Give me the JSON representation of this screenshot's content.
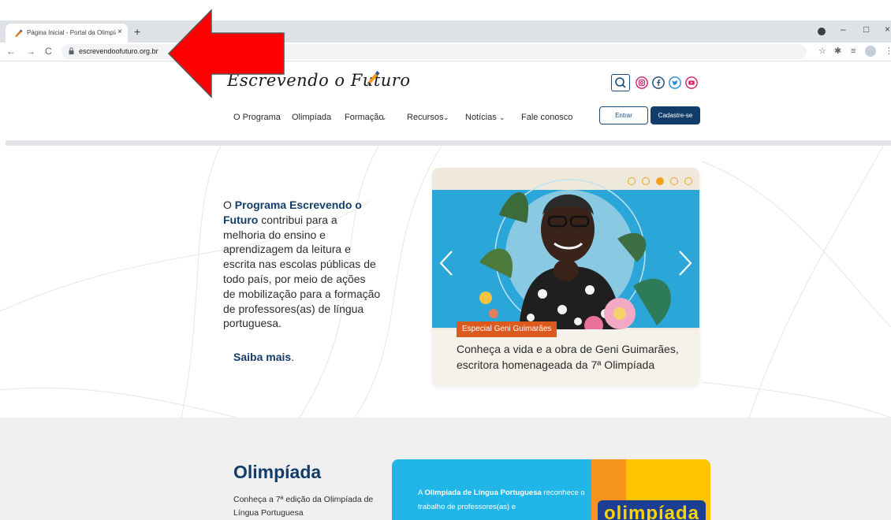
{
  "browser": {
    "tab_title": "Página Inicial - Portal da Olimpíada",
    "tab_close": "×",
    "new_tab": "+",
    "url": "escrevendoofuturo.org.br",
    "nav_back": "←",
    "nav_forward": "→",
    "nav_reload": "C",
    "window_minimize": "–",
    "window_maximize": "□",
    "window_close": "×",
    "toolbar_star": "☆",
    "toolbar_extensions": "✱",
    "toolbar_readinglist": "≡",
    "toolbar_menu": "⋮"
  },
  "header": {
    "logo_text": "Escrevendo o Futuro",
    "nav_items": [
      "O Programa",
      "Olimpíada",
      "Formação",
      "Recursos",
      "Notícias",
      "Fale conosco"
    ],
    "nav_dropdown_indicator": "⌄",
    "login_label": "Entrar",
    "signup_label": "Cadastre-se",
    "social_icons": [
      "instagram-icon",
      "facebook-icon",
      "twitter-icon",
      "youtube-icon"
    ]
  },
  "intro": {
    "text_before": "O ",
    "highlight": "Programa Escrevendo o Futuro",
    "text_after": " contribui para a melhoria do ensino e aprendizagem da leitura e escrita nas escolas públicas de todo país, por meio de ações de mobilização para a formação de professores(as) de língua portuguesa.",
    "link_text": "Saiba mais",
    "link_suffix": "."
  },
  "carousel": {
    "badge": "Especial Geni Guimarães",
    "caption": "Conheça a vida e a obra de Geni Guimarães, escritora homenageada da 7ª Olimpíada",
    "slide_count": 5,
    "active_slide": 3
  },
  "olimpiada": {
    "title": "Olimpíada",
    "subtitle": "Conheça a 7ª edição da Olimpíada de Língua Portuguesa",
    "card_text_bold": "Olimpíada de Língua Portuguesa",
    "card_text_prefix": "A ",
    "card_text_after": " reconhece o trabalho de professores(as) e",
    "logo_word": "olimpíada"
  },
  "colors": {
    "brand_navy": "#123d6a",
    "accent_orange": "#dc5a1d",
    "accent_yellow": "#f0a21e",
    "card_blue": "#21b5e8",
    "annotation_red": "#ff0000"
  }
}
